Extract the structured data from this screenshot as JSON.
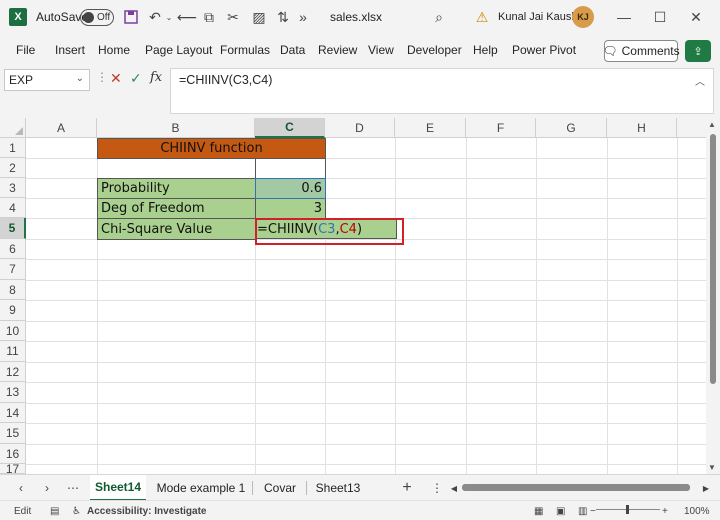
{
  "titlebar": {
    "autosave_label": "AutoSave",
    "autosave_state": "Off",
    "overflow": "»",
    "filename": "sales.xlsx",
    "user_name": "Kunal Jai Kaushik",
    "user_initials": "KJ"
  },
  "menu": {
    "items": [
      "File",
      "Insert",
      "Home",
      "Page Layout",
      "Formulas",
      "Data",
      "Review",
      "View",
      "Developer",
      "Help",
      "Power Pivot"
    ],
    "comments_label": "Comments"
  },
  "formula_bar": {
    "name_box": "EXP",
    "formula": "=CHIINV(C3,C4)"
  },
  "grid": {
    "columns": [
      "A",
      "B",
      "C",
      "D",
      "E",
      "F",
      "G",
      "H"
    ],
    "active_column": "C",
    "rows": [
      "1",
      "2",
      "3",
      "4",
      "5",
      "6",
      "7",
      "8",
      "9",
      "10",
      "11",
      "12",
      "13",
      "14",
      "15",
      "16",
      "17"
    ],
    "active_row": "5",
    "title": "CHIINV function",
    "labels": [
      "Probability",
      "Deg of Freedom",
      "Chi-Square Value"
    ],
    "probability": "0.6",
    "degrees_of_freedom": "3",
    "editing": {
      "prefix": "=CHIINV(",
      "ref1": "C3",
      "comma": ",",
      "ref2": "C4",
      "suffix": ")"
    }
  },
  "sheets": {
    "tabs": [
      "Sheet14",
      "Mode example 1",
      "Covar",
      "Sheet13"
    ],
    "active": "Sheet14",
    "add": "+",
    "more": "⋮"
  },
  "status": {
    "mode": "Edit",
    "accessibility": "Accessibility: Investigate",
    "zoom": "100%"
  },
  "colors": {
    "title_fill": "#c65911",
    "data_fill": "#a9d08e",
    "ref1_color": "#2f75b5",
    "ref2_color": "#c00000",
    "highlight_box": "#d0202a",
    "excel_green": "#217346"
  }
}
